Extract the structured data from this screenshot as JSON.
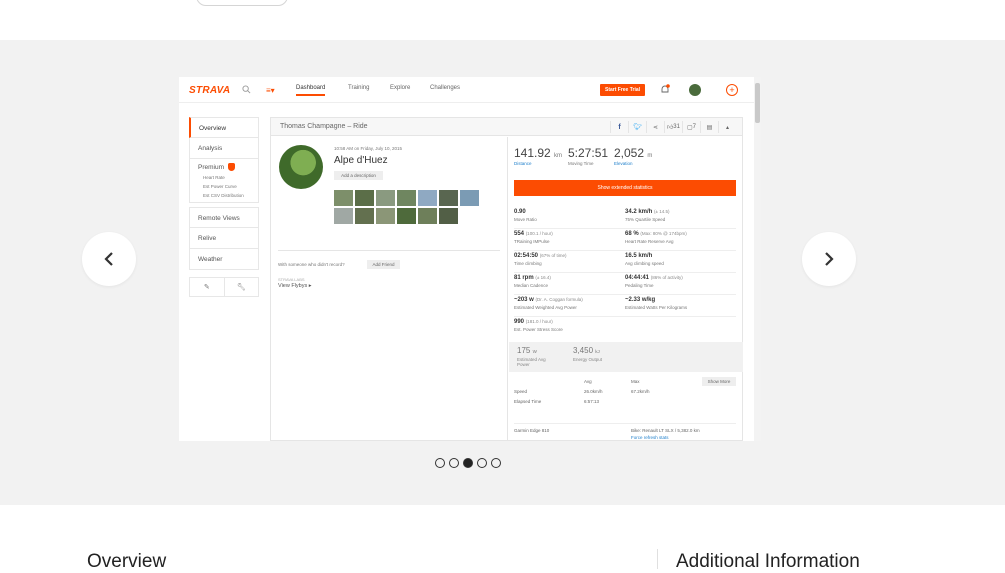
{
  "carousel": {
    "dots_total": 5,
    "active_dot_index": 2,
    "screenshot": {
      "app": {
        "logo": "STRAVA",
        "nav": [
          "Dashboard",
          "Training",
          "Explore",
          "Challenges"
        ],
        "trial_button": "Start Free Trial"
      },
      "sidebar": {
        "items_top": [
          "Overview",
          "Analysis"
        ],
        "premium_label": "Premium",
        "premium_sub": [
          "Heart Rate",
          "Est Power Curve",
          "Est CSV Distribution"
        ],
        "items_bottom": [
          "Remote Views",
          "Relive",
          "Weather"
        ]
      },
      "activity": {
        "header_title": "Thomas Champagne – Ride",
        "kudos": "31",
        "comments": "7",
        "date": "10:58 AM on Friday, July 10, 2015",
        "title": "Alpe d'Huez",
        "add_description": "Add a description",
        "with_someone": "With someone who didn't record?",
        "add_friend": "Add Friend",
        "flybys_label": "STRAVA LABS",
        "flybys": "View Flybys"
      },
      "summary": {
        "distance_value": "141.92",
        "distance_unit": "km",
        "distance_label": "Distance",
        "moving_time_value": "5:27:51",
        "moving_time_label": "Moving Time",
        "elevation_value": "2,052",
        "elevation_unit": "m",
        "elevation_label": "Elevation",
        "extended_button": "Show extended statistics"
      },
      "stats": [
        {
          "value": "0.90",
          "extra": "",
          "label": "Move Ratio"
        },
        {
          "value": "34.2 km/h",
          "extra": "(± 14.5)",
          "label": "75% Quartile Speed"
        },
        {
          "value": "554",
          "extra": "(100.1 / hour)",
          "label": "TRaining IMPulse"
        },
        {
          "value": "68 %",
          "extra": "(Max: 80% @ 174bpm)",
          "label": "Heart Rate Reserve Avg"
        },
        {
          "value": "02:54:50",
          "extra": "(67% of time)",
          "label": "Time climbing"
        },
        {
          "value": "16.5 km/h",
          "extra": "",
          "label": "Avg climbing speed"
        },
        {
          "value": "81 rpm",
          "extra": "(± 16.4)",
          "label": "Median Cadence"
        },
        {
          "value": "04:44:41",
          "extra": "(86% of activity)",
          "label": "Pedaling Time"
        },
        {
          "value": "~203 w",
          "extra": "(Dr. A. Coggan formula)",
          "label": "Estimated Weighted Avg Power"
        },
        {
          "value": "~2.33 w/kg",
          "extra": "",
          "label": "Estimated Watts Per Kilograms"
        },
        {
          "value": "990",
          "extra": "(181.0 / hour)",
          "label": "Est. Power Stress Score"
        }
      ],
      "grey_stats": {
        "avg_power_value": "175",
        "avg_power_unit": "W",
        "avg_power_label": "Estimated Avg Power",
        "energy_value": "3,450",
        "energy_unit": "kJ",
        "energy_label": "Energy Output"
      },
      "table": {
        "col_avg": "Avg",
        "col_max": "Max",
        "show_more": "Show More",
        "speed_label": "Speed",
        "speed_avg": "26.0km/h",
        "speed_max": "67.2km/h",
        "elapsed_label": "Elapsed Time",
        "elapsed_value": "6:57:13"
      },
      "device": {
        "name": "Garmin Edge 810",
        "bike": "Bike: Renault LT SLX / 5,382.0 km",
        "refresh": "Force refresh stats"
      }
    }
  },
  "bottom": {
    "overview_heading": "Overview",
    "additional_heading": "Additional Information"
  },
  "colors": {
    "strava_orange": "#fc4c02",
    "carousel_bg": "#f2f2f2"
  }
}
